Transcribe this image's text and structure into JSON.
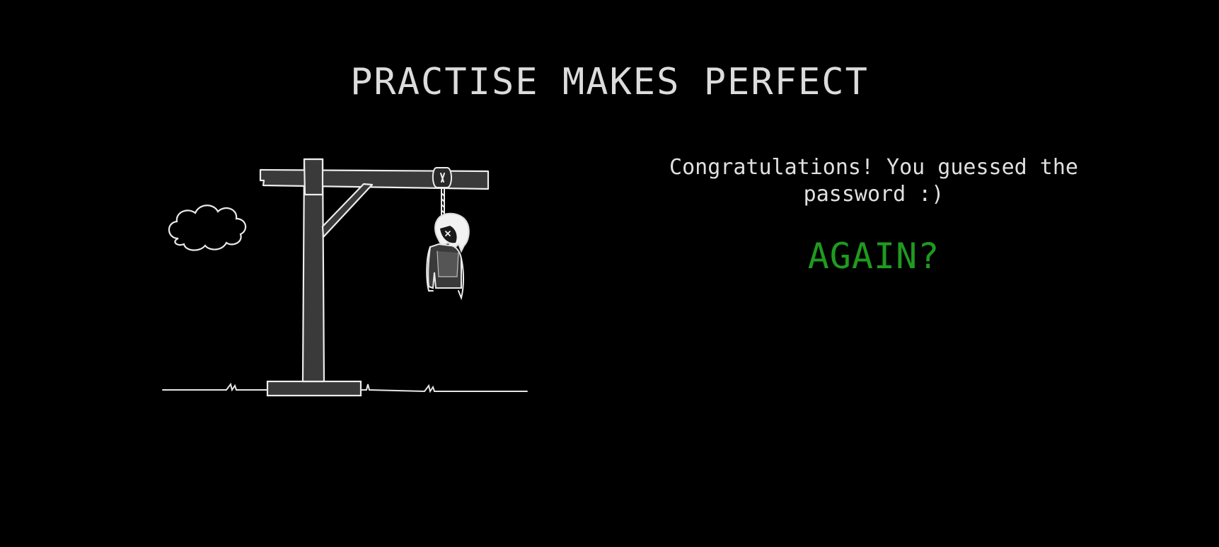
{
  "header": {
    "title": "PRACTISE MAKES PERFECT"
  },
  "game": {
    "result_message": "Congratulations! You guessed the password :)",
    "again_label": "AGAIN?"
  },
  "colors": {
    "background": "#000000",
    "text": "#e0e0e0",
    "again_accent": "#1f9a1f"
  },
  "illustration": {
    "icons": [
      "cloud-icon",
      "gallows-icon",
      "hanged-figure-icon",
      "ground-line-icon"
    ]
  }
}
